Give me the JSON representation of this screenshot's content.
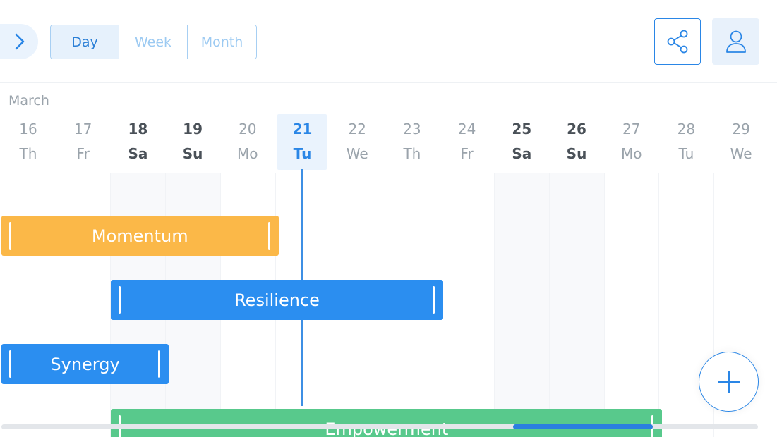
{
  "toolbar": {
    "views": [
      {
        "label": "Day",
        "active": true
      },
      {
        "label": "Week",
        "active": false
      },
      {
        "label": "Month",
        "active": false
      }
    ],
    "icons": {
      "nav": "chevron-right-icon",
      "share": "share-icon",
      "profile": "user-icon"
    }
  },
  "timeline": {
    "month": "March",
    "days": [
      {
        "num": "16",
        "dow": "Th",
        "type": "weekday"
      },
      {
        "num": "17",
        "dow": "Fr",
        "type": "weekday"
      },
      {
        "num": "18",
        "dow": "Sa",
        "type": "weekend"
      },
      {
        "num": "19",
        "dow": "Su",
        "type": "weekend"
      },
      {
        "num": "20",
        "dow": "Mo",
        "type": "weekday"
      },
      {
        "num": "21",
        "dow": "Tu",
        "type": "today"
      },
      {
        "num": "22",
        "dow": "We",
        "type": "weekday"
      },
      {
        "num": "23",
        "dow": "Th",
        "type": "weekday"
      },
      {
        "num": "24",
        "dow": "Fr",
        "type": "weekday"
      },
      {
        "num": "25",
        "dow": "Sa",
        "type": "weekend"
      },
      {
        "num": "26",
        "dow": "Su",
        "type": "weekend"
      },
      {
        "num": "27",
        "dow": "Mo",
        "type": "weekday"
      },
      {
        "num": "28",
        "dow": "Tu",
        "type": "weekday"
      },
      {
        "num": "29",
        "dow": "We",
        "type": "weekday"
      }
    ],
    "tasks": [
      {
        "label": "Momentum",
        "color": "#fbb848",
        "start": "16",
        "end": "21"
      },
      {
        "label": "Resilience",
        "color": "#2b8ef0",
        "start": "18",
        "end": "24"
      },
      {
        "label": "Synergy",
        "color": "#2b8ef0",
        "start": "16",
        "end": "19"
      },
      {
        "label": "Empowerment",
        "color": "#58c98c",
        "start": "18",
        "end": "28"
      }
    ]
  },
  "colors": {
    "accent": "#2a86e6",
    "orange": "#fbb848",
    "blue": "#2b8ef0",
    "green": "#58c98c"
  },
  "icons": {
    "collapse": "chevron-down-icon",
    "add": "plus-icon"
  }
}
